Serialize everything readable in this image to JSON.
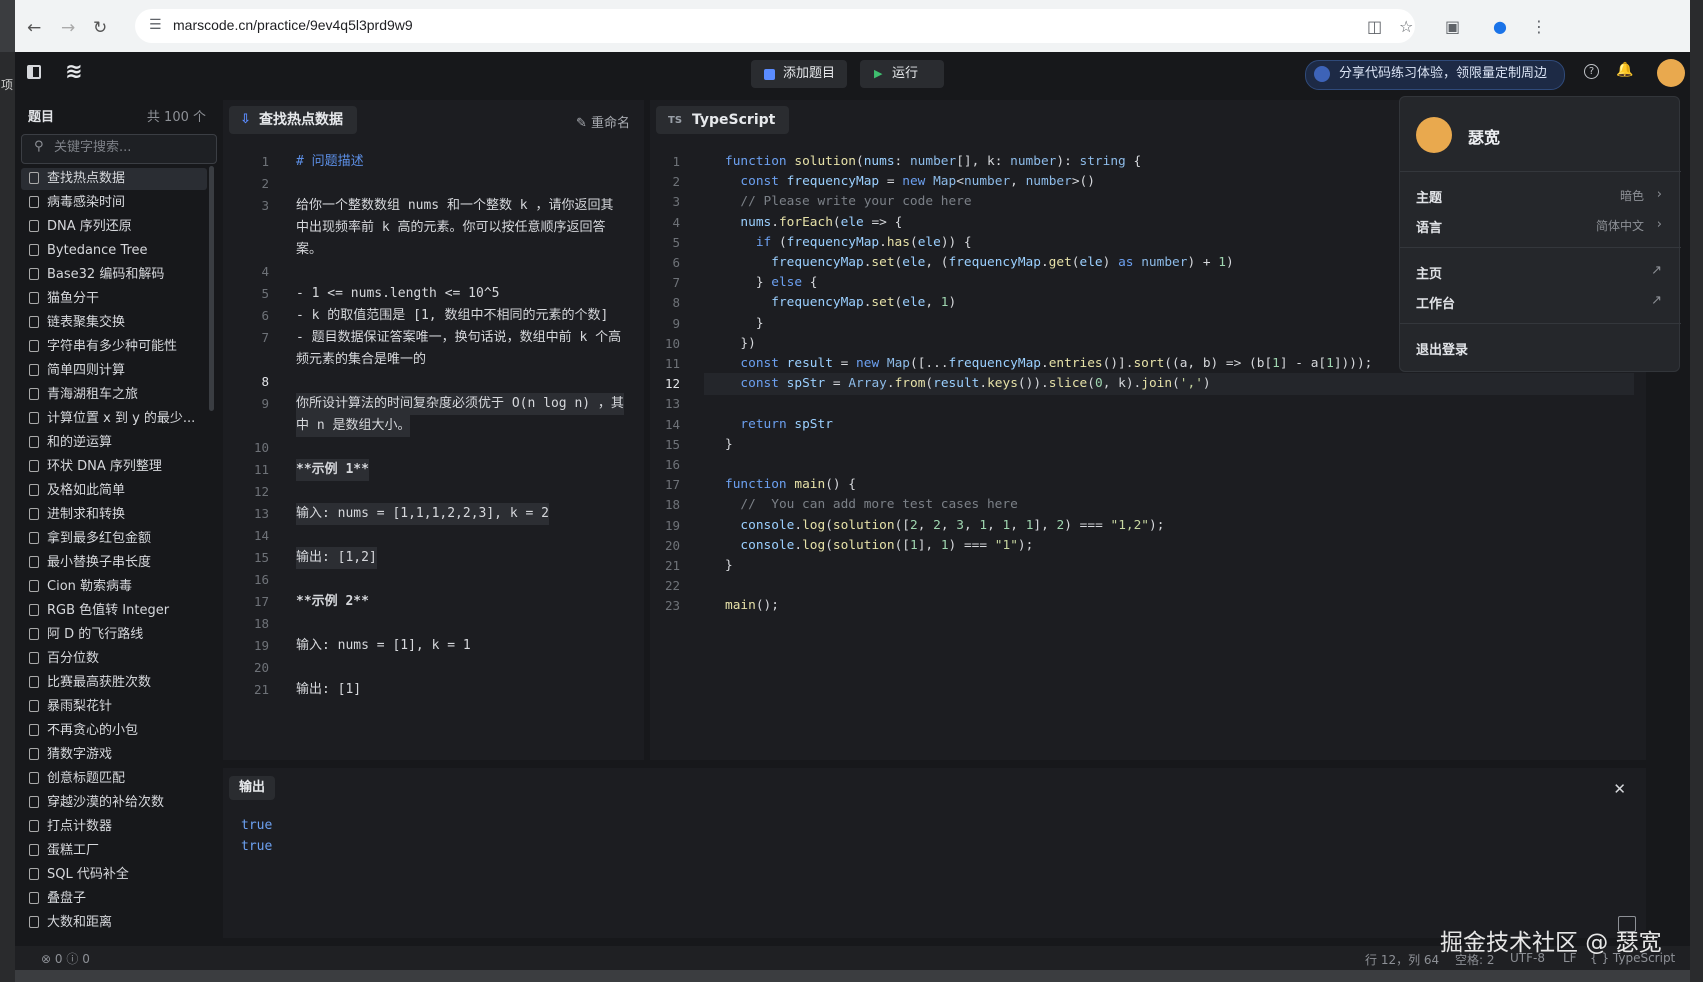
{
  "browser": {
    "url": "marscode.cn/practice/9ev4q5l3prd9w9",
    "left_strip_text": "项"
  },
  "toolbar": {
    "add_problem": "添加题目",
    "run": "运行",
    "share_banner": "分享代码练习体验，领限量定制周边"
  },
  "sidebar": {
    "title": "题目",
    "count": "共 100 个",
    "search_placeholder": "关键字搜索...",
    "items": [
      "查找热点数据",
      "病毒感染时间",
      "DNA 序列还原",
      "Bytedance Tree",
      "Base32 编码和解码",
      "猫鱼分干",
      "链表聚集交换",
      "字符串有多少种可能性",
      "简单四则计算",
      "青海湖租车之旅",
      "计算位置 x 到 y 的最少...",
      "和的逆运算",
      "环状 DNA 序列整理",
      "及格如此简单",
      "进制求和转换",
      "拿到最多红包金额",
      "最小替换子串长度",
      "Cion 勒索病毒",
      "RGB 色值转 Integer",
      "阿 D 的飞行路线",
      "百分位数",
      "比赛最高获胜次数",
      "暴雨梨花针",
      "不再贪心的小包",
      "猜数字游戏",
      "创意标题匹配",
      "穿越沙漠的补给次数",
      "打点计数器",
      "蛋糕工厂",
      "SQL 代码补全",
      "叠盘子",
      "大数和距离"
    ]
  },
  "problem": {
    "tab": "查找热点数据",
    "rename": "重命名",
    "line_numbers": [
      "1",
      "2",
      "3",
      "4",
      "5",
      "6",
      "7",
      "8",
      "9",
      "10",
      "11",
      "12",
      "13",
      "14",
      "15",
      "16",
      "17",
      "18",
      "19",
      "20",
      "21"
    ],
    "lines": {
      "l1": "# 问题描述",
      "l3a": "给你一个整数数组 nums 和一个整数 k ，请你返回其",
      "l3b": "中出现频率前 k 高的元素。你可以按任意顺序返回答",
      "l3c": "案。",
      "l5": "- 1 <= nums.length <= 10^5",
      "l6": "- k 的取值范围是 [1, 数组中不相同的元素的个数]",
      "l7a": "- 题目数据保证答案唯一，换句话说，数组中前 k 个高",
      "l7b": "频元素的集合是唯一的",
      "l9a": "你所设计算法的时间复杂度必须优于 O(n log n) ，其",
      "l9b": "中 n 是数组大小。",
      "l11": "**示例 1**",
      "l13": "输入: nums = [1,1,1,2,2,3], k = 2",
      "l15": "输出: [1,2]",
      "l17": "**示例 2**",
      "l19": "输入: nums = [1], k = 1",
      "l21": "输出: [1]"
    }
  },
  "editor": {
    "tab": "TypeScript",
    "tab_icon": "TS",
    "current_line": "12",
    "line_numbers": [
      "1",
      "2",
      "3",
      "4",
      "5",
      "6",
      "7",
      "8",
      "9",
      "10",
      "11",
      "12",
      "13",
      "14",
      "15",
      "16",
      "17",
      "18",
      "19",
      "20",
      "21",
      "22",
      "23"
    ],
    "code": [
      "function solution(nums: number[], k: number): string {",
      "  const frequencyMap = new Map<number, number>()",
      "  // Please write your code here",
      "  nums.forEach(ele => {",
      "    if (frequencyMap.has(ele)) {",
      "      frequencyMap.set(ele, (frequencyMap.get(ele) as number) + 1)",
      "    } else {",
      "      frequencyMap.set(ele, 1)",
      "    }",
      "  })",
      "  const result = new Map([...frequencyMap.entries()].sort((a, b) => (b[1] - a[1])));",
      "  const spStr = Array.from(result.keys()).slice(0, k).join(',')",
      "",
      "  return spStr",
      "}",
      "",
      "function main() {",
      "  //  You can add more test cases here",
      "  console.log(solution([2, 2, 3, 1, 1, 1], 2) === \"1,2\");",
      "  console.log(solution([1], 1) === \"1\");",
      "}",
      "",
      "main();"
    ]
  },
  "output": {
    "tab": "输出",
    "lines": [
      "true",
      "true"
    ]
  },
  "status": {
    "errors": "0",
    "warnings": "0",
    "position": "行 12，列 64",
    "spaces": "空格: 2",
    "encoding": "UTF-8",
    "eol": "LF",
    "language": "{ } TypeScript"
  },
  "watermark": "掘金技术社区 @ 瑟宽",
  "user_menu": {
    "username": "瑟宽",
    "theme_label": "主题",
    "theme_value": "暗色",
    "language_label": "语言",
    "language_value": "简体中文",
    "home": "主页",
    "workbench": "工作台",
    "logout": "退出登录"
  },
  "colors": {
    "accent_blue": "#5b8cff",
    "run_green": "#3fbf6f",
    "avatar": "#e9a94e"
  }
}
